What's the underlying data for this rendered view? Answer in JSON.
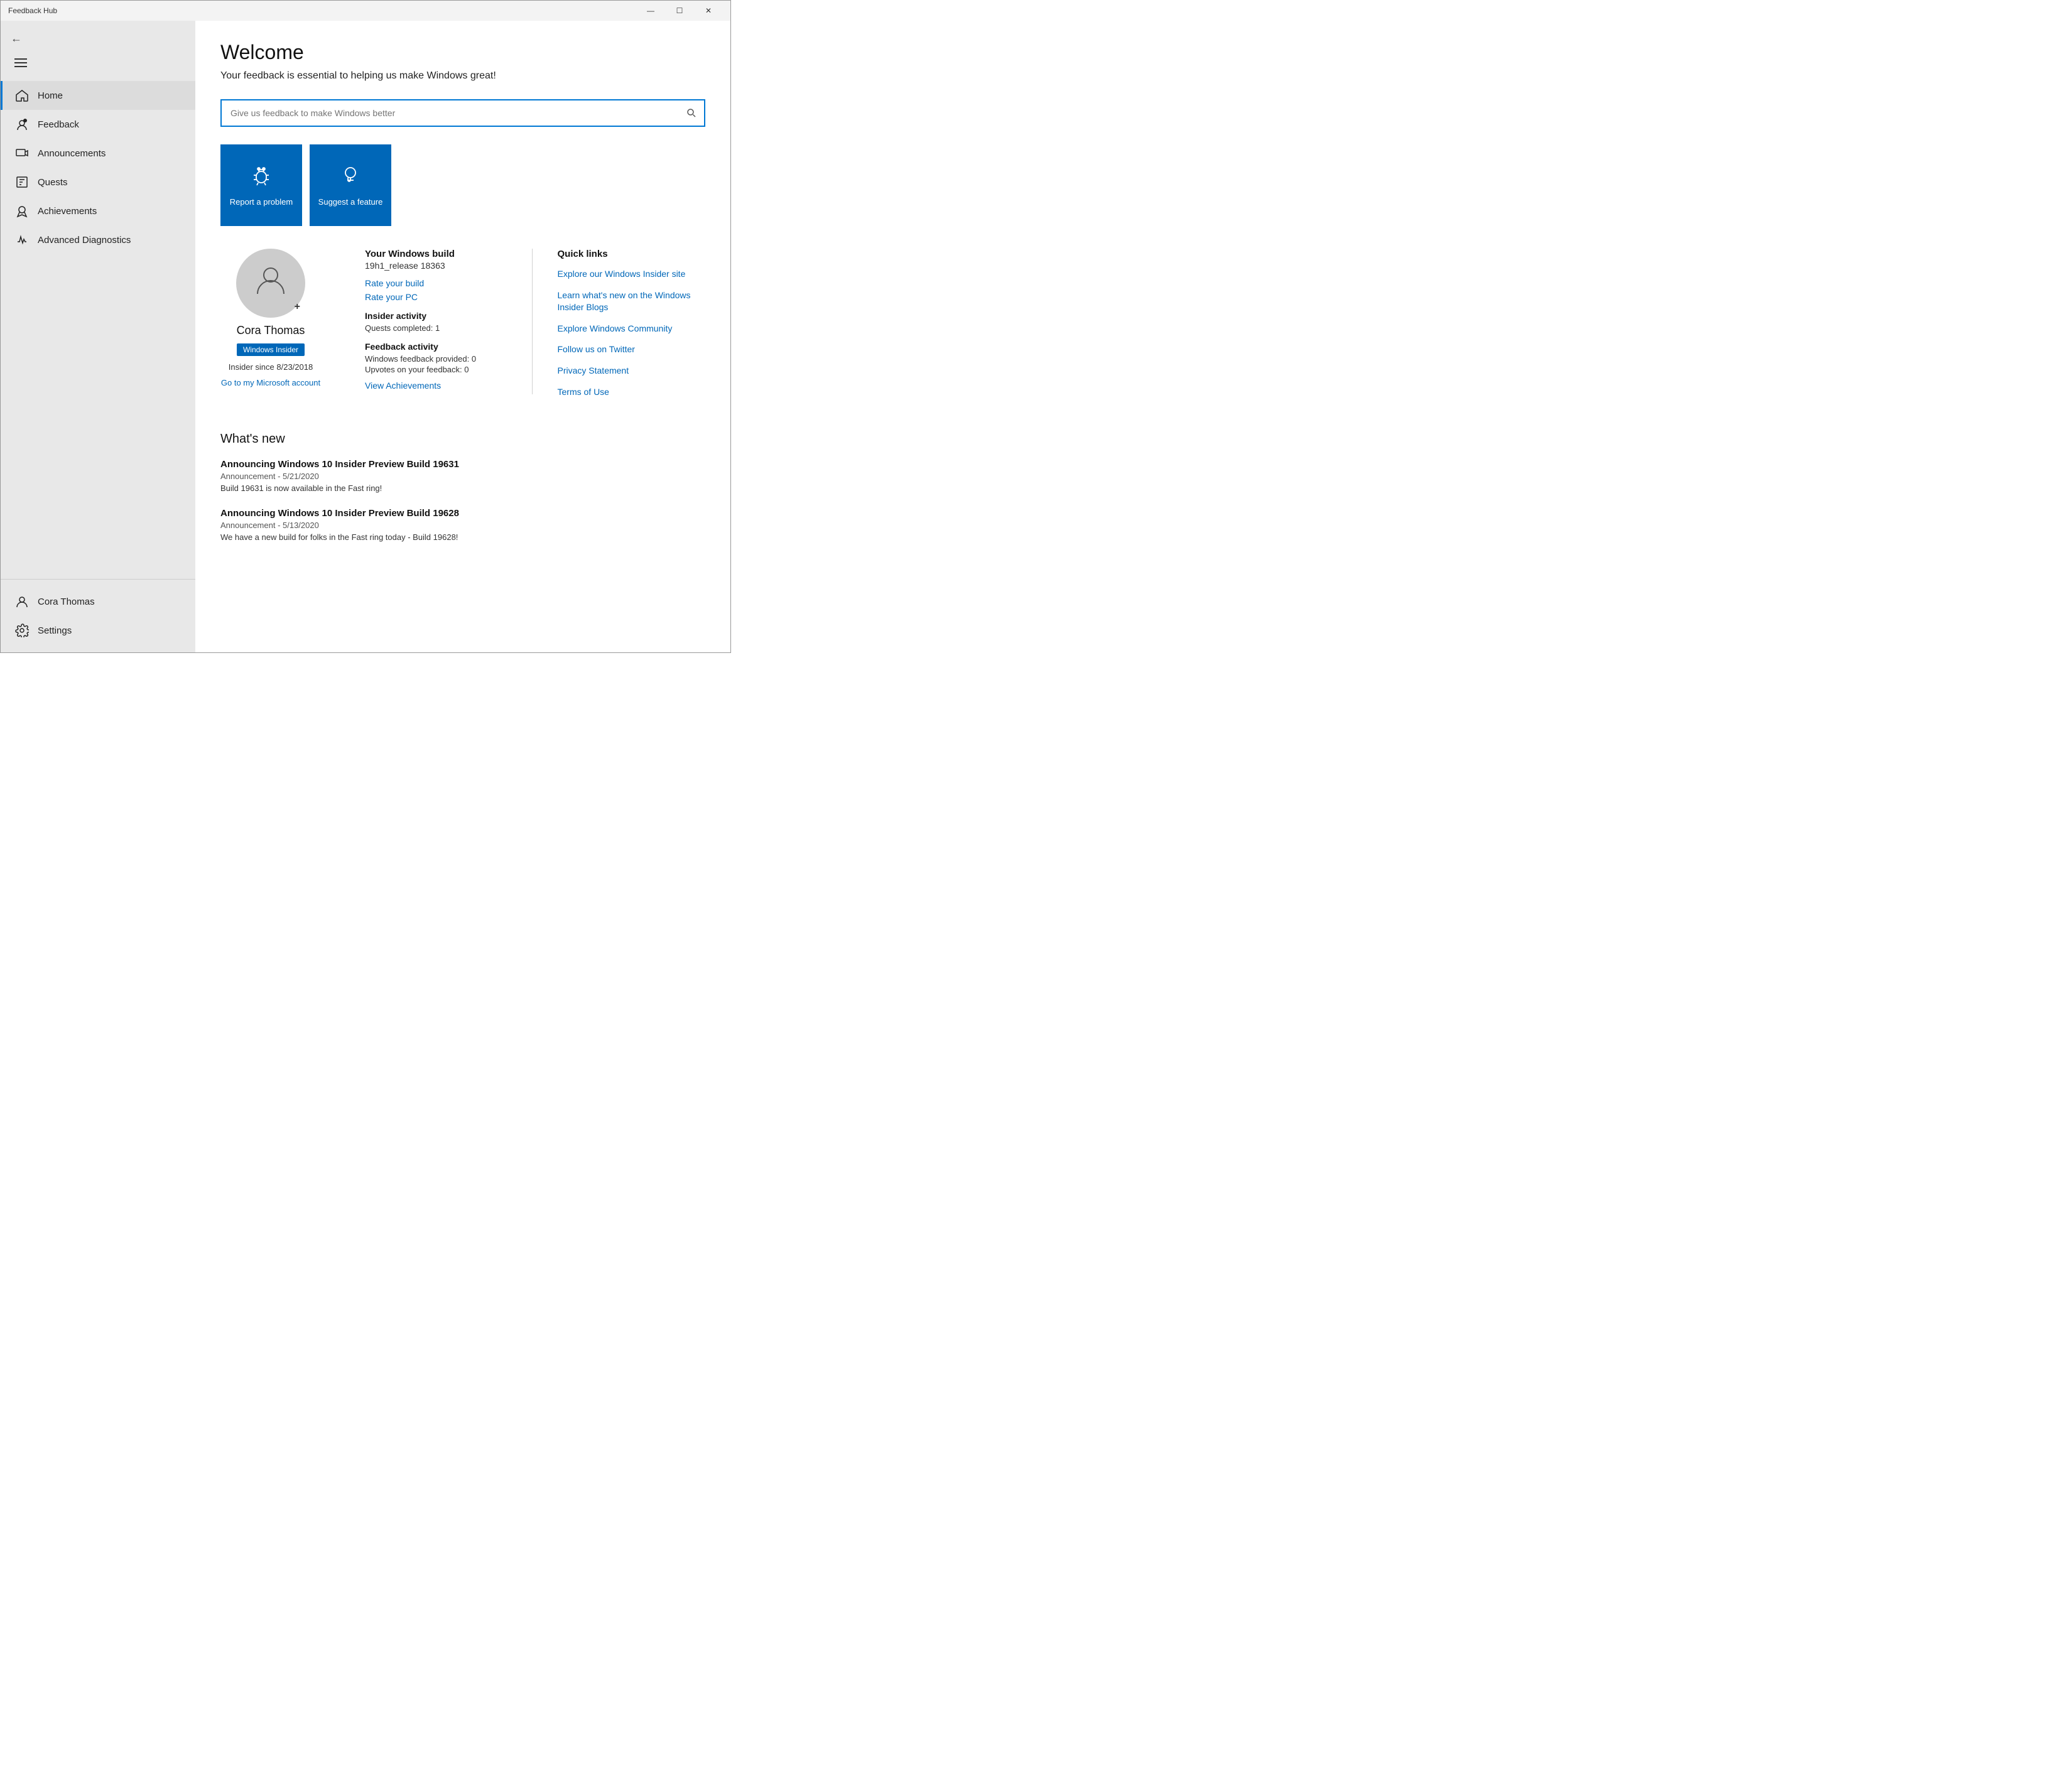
{
  "titlebar": {
    "title": "Feedback Hub",
    "min_label": "—",
    "max_label": "☐",
    "close_label": "✕"
  },
  "sidebar": {
    "nav_items": [
      {
        "id": "home",
        "label": "Home",
        "icon": "home",
        "active": true
      },
      {
        "id": "feedback",
        "label": "Feedback",
        "icon": "feedback",
        "active": false
      },
      {
        "id": "announcements",
        "label": "Announcements",
        "icon": "announcements",
        "active": false
      },
      {
        "id": "quests",
        "label": "Quests",
        "icon": "quests",
        "active": false
      },
      {
        "id": "achievements",
        "label": "Achievements",
        "icon": "achievements",
        "active": false
      },
      {
        "id": "advanced-diagnostics",
        "label": "Advanced Diagnostics",
        "icon": "diagnostics",
        "active": false
      }
    ],
    "bottom_items": [
      {
        "id": "cora-thomas",
        "label": "Cora Thomas",
        "icon": "user"
      },
      {
        "id": "settings",
        "label": "Settings",
        "icon": "settings"
      }
    ]
  },
  "content": {
    "welcome_title": "Welcome",
    "welcome_subtitle": "Your feedback is essential to helping us make Windows great!",
    "search_placeholder": "Give us feedback to make Windows better",
    "action_cards": [
      {
        "id": "report-problem",
        "label": "Report a problem",
        "icon": "bug"
      },
      {
        "id": "suggest-feature",
        "label": "Suggest a feature",
        "icon": "lightbulb"
      }
    ],
    "profile": {
      "name": "Cora Thomas",
      "badge": "Windows Insider",
      "insider_since": "Insider since 8/23/2018",
      "ms_account_link": "Go to my Microsoft account",
      "build_label": "Your Windows build",
      "build_value": "19h1_release 18363",
      "rate_build_link": "Rate your build",
      "rate_pc_link": "Rate your PC",
      "insider_activity_label": "Insider activity",
      "quests_completed": "Quests completed: 1",
      "feedback_activity_label": "Feedback activity",
      "windows_feedback": "Windows feedback provided: 0",
      "upvotes": "Upvotes on your feedback: 0",
      "view_achievements_link": "View Achievements"
    },
    "quick_links": {
      "title": "Quick links",
      "items": [
        {
          "id": "explore-insider",
          "label": "Explore our Windows Insider site"
        },
        {
          "id": "learn-new",
          "label": "Learn what's new on the Windows Insider Blogs"
        },
        {
          "id": "explore-community",
          "label": "Explore Windows Community"
        },
        {
          "id": "twitter",
          "label": "Follow us on Twitter"
        },
        {
          "id": "privacy",
          "label": "Privacy Statement"
        },
        {
          "id": "terms",
          "label": "Terms of Use"
        }
      ]
    },
    "whats_new": {
      "title": "What's new",
      "items": [
        {
          "id": "build-19631",
          "title": "Announcing Windows 10 Insider Preview Build 19631",
          "meta": "Announcement  -  5/21/2020",
          "desc": "Build 19631 is now available in the Fast ring!"
        },
        {
          "id": "build-19628",
          "title": "Announcing Windows 10 Insider Preview Build 19628",
          "meta": "Announcement  -  5/13/2020",
          "desc": "We have a new build for folks in the Fast ring today - Build 19628!"
        }
      ]
    }
  }
}
